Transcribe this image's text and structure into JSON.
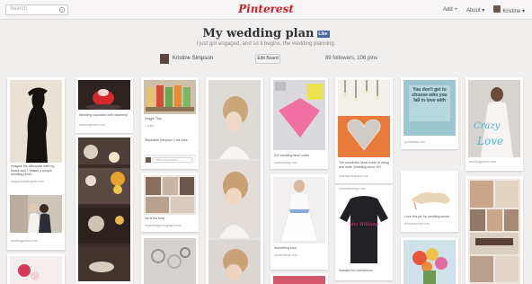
{
  "topbar": {
    "search_placeholder": "Search",
    "logo": "Pinterest",
    "nav_add": "Add +",
    "nav_about": "About ▾",
    "nav_user": "Kristine ▾"
  },
  "board": {
    "title": "My wedding plan",
    "like_label": "Like",
    "description": "I just got engaged, and so it begins, the wedding planning.",
    "owner": "Kristine Simpson",
    "edit_label": "Edit Board",
    "stats": "89 followers, 106 pins"
  },
  "pins": {
    "p1_caption": "Imagine the silhouette with my fiancé and I. Makes a unique wedding photo.",
    "p1_source": "elegantweddinghub.com",
    "p2_source": "weddingphotos.com",
    "p3_caption": "Wedding cupcakes with raspberry",
    "p3_source": "weddingbrides.com",
    "p5_caption": "Veggie Tray",
    "p5_repins": "1 repin",
    "p5_commenter": "Stephanie Simpson Cute idea",
    "p5_comment_placeholder": "Add a comment...",
    "p6_caption": "Ne is the best",
    "p6_source": "flowerfieldphotography.com",
    "p7_caption": "",
    "p8_caption": "DIY wedding favor cards",
    "p8_source": "hostessblog.com",
    "p9_caption": "Something blue...",
    "p9_source": "modernbride.com",
    "p10_caption": "The wonderful heart made of string and nails. Wedding decor DIY",
    "p10_source": "heartdiy.blogspot.com",
    "p11_source": "sheswilddesign.com",
    "p11_shirt_text": "Mrs Williams",
    "p11_caption": "Sweater for honeymoon",
    "p12_quote": "You don't get to choose who you fall in love with",
    "p12_source": "quotesday.com",
    "p13_caption": "Love this pic for wedding shoes",
    "p13_source": "dreamcountry.com",
    "p14_source": "weddingphotos.com",
    "p14_word1": "Crazy",
    "p14_word2": "Love"
  },
  "colors": {
    "brand": "#c8232c",
    "background": "#f1eeee"
  }
}
